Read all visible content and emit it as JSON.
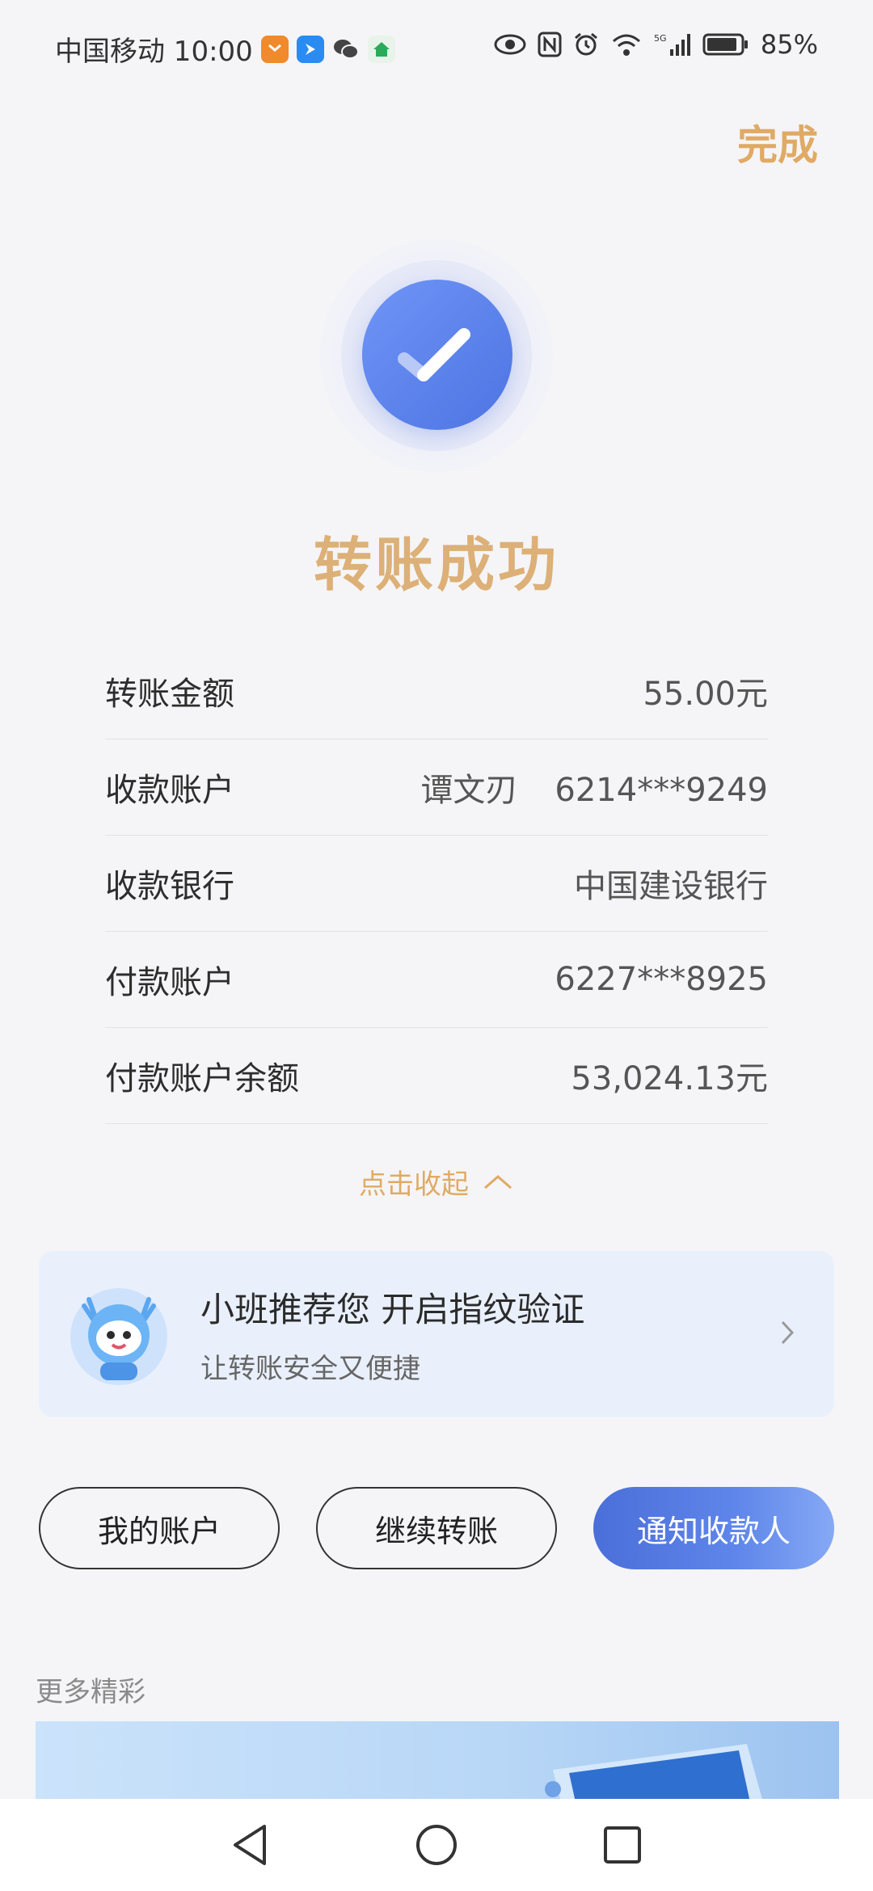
{
  "status_bar": {
    "carrier_time": "中国移动 10:00",
    "battery": "85%",
    "icons": [
      "app-orange-icon",
      "app-blue-icon",
      "wechat-icon",
      "app-green-icon",
      "eye-icon",
      "nfc-icon",
      "alarm-icon",
      "wifi-icon",
      "signal-5g-icon",
      "battery-icon"
    ]
  },
  "header": {
    "done_label": "完成"
  },
  "result": {
    "title": "转账成功",
    "icon": "check-icon",
    "accent": "#dcb077"
  },
  "details": [
    {
      "label": "转账金额",
      "value": "55.00元"
    },
    {
      "label": "收款账户",
      "name": "谭文刃",
      "value": "6214***9249"
    },
    {
      "label": "收款银行",
      "value": "中国建设银行"
    },
    {
      "label": "付款账户",
      "value": "6227***8925"
    },
    {
      "label": "付款账户余额",
      "value": "53,024.13元"
    }
  ],
  "collapse_label": "点击收起",
  "promo": {
    "title": "小班推荐您 开启指纹验证",
    "subtitle": "让转账安全又便捷"
  },
  "actions": {
    "my_account": "我的账户",
    "continue_transfer": "继续转账",
    "notify_payee": "通知收款人"
  },
  "more": {
    "label": "更多精彩"
  },
  "colors": {
    "primary": "#4a6fd9",
    "gold": "#e0aa64"
  }
}
